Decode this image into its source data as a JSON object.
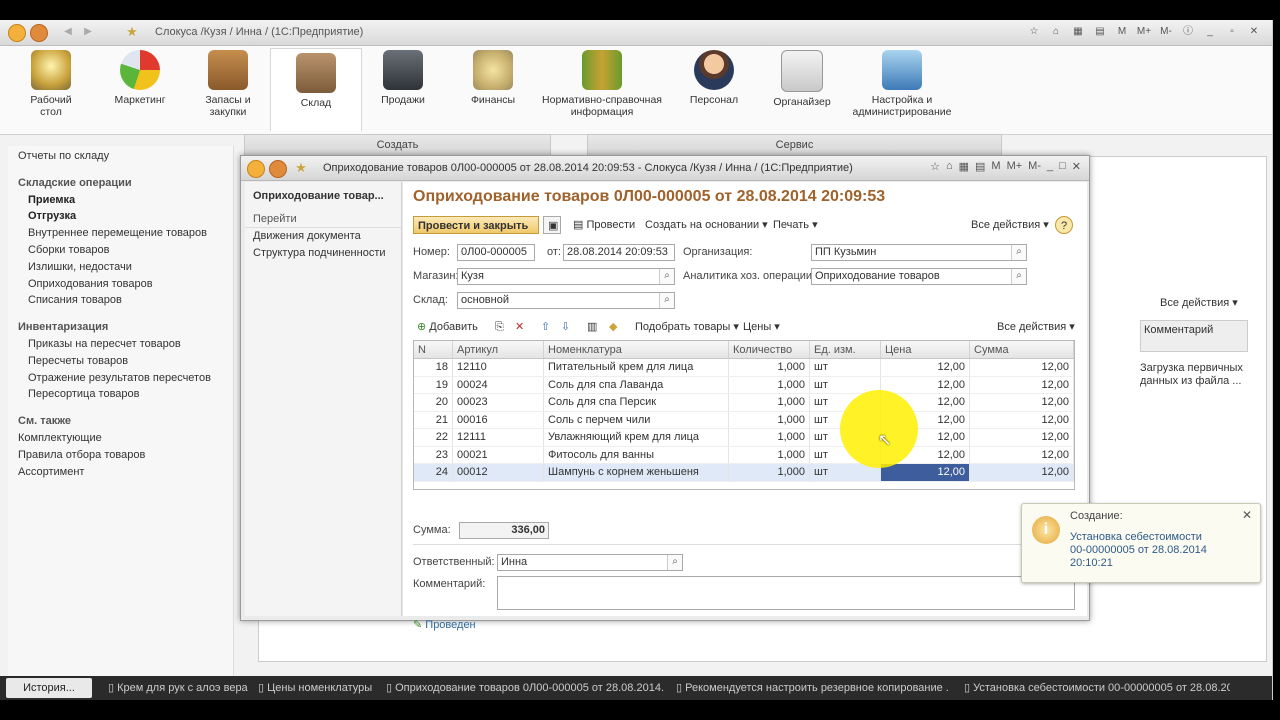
{
  "app": {
    "title": "Слокуса /Кузя / Инна /  (1С:Предприятие)"
  },
  "sections": [
    {
      "label": "Рабочий стол",
      "icon": "desktop-icon"
    },
    {
      "label": "Маркетинг",
      "icon": "pie-chart-icon"
    },
    {
      "label": "Запасы и закупки",
      "icon": "boxes-icon"
    },
    {
      "label": "Склад",
      "icon": "warehouse-icon"
    },
    {
      "label": "Продажи",
      "icon": "cash-register-icon"
    },
    {
      "label": "Финансы",
      "icon": "coins-icon"
    },
    {
      "label": "Нормативно-справочная информация",
      "icon": "binders-icon"
    },
    {
      "label": "Персонал",
      "icon": "person-icon"
    },
    {
      "label": "Органайзер",
      "icon": "checklist-icon"
    },
    {
      "label": "Настройка и администрирование",
      "icon": "computer-icon"
    }
  ],
  "subbar": {
    "create": "Создать",
    "service": "Сервис"
  },
  "leftnav": {
    "reports": "Отчеты по складу",
    "ops_header": "Складские операции",
    "ops": [
      "Приемка",
      "Отгрузка",
      "Внутреннее перемещение товаров",
      "Сборки товаров",
      "Излишки, недостачи",
      "Оприходования товаров",
      "Списания товаров"
    ],
    "inv_header": "Инвентаризация",
    "inv": [
      "Приказы на пересчет товаров",
      "Пересчеты товаров",
      "Отражение результатов пересчетов",
      "Пересортица товаров"
    ],
    "see_header": "См. также",
    "see": [
      "Комплектующие",
      "Правила отбора товаров",
      "Ассортимент"
    ]
  },
  "background": {
    "all_actions": "Все действия",
    "comment_col": "Комментарий",
    "comment_cell": "Загрузка первичных данных из файла ..."
  },
  "dialog": {
    "window_title": "Оприходование товаров 0Л00-000005 от 28.08.2014 20:09:53 - Слокуса /Кузя / Инна /  (1С:Предприятие)",
    "left_title": "Оприходование товар...",
    "goto": "Перейти",
    "links": [
      "Движения документа",
      "Структура подчиненности"
    ],
    "doc_title": "Оприходование товаров 0Л00-000005 от 28.08.2014 20:09:53",
    "toolbar": {
      "post_close": "Провести и закрыть",
      "post": "Провести",
      "create_based": "Создать на основании",
      "print": "Печать",
      "all_actions": "Все действия",
      "help": "?"
    },
    "fields": {
      "number_label": "Номер:",
      "number": "0Л00-000005",
      "date_label": "от:",
      "date": "28.08.2014 20:09:53",
      "org_label": "Организация:",
      "org": "ПП Кузьмин",
      "store_label": "Магазин:",
      "store": "Кузя",
      "analytics_label": "Аналитика хоз. операции:",
      "analytics": "Оприходование товаров",
      "warehouse_label": "Склад:",
      "warehouse": "основной"
    },
    "table_toolbar": {
      "add": "Добавить",
      "pick": "Подобрать товары",
      "prices": "Цены",
      "all_actions": "Все действия"
    },
    "columns": [
      "N",
      "Артикул",
      "Номенклатура",
      "Количество",
      "Ед. изм.",
      "Цена",
      "Сумма"
    ],
    "rows": [
      {
        "n": "18",
        "sku": "12110",
        "name": "Питательный крем для лица",
        "qty": "1,000",
        "unit": "шт",
        "price": "12,00",
        "sum": "12,00"
      },
      {
        "n": "19",
        "sku": "00024",
        "name": "Соль для спа Лаванда",
        "qty": "1,000",
        "unit": "шт",
        "price": "12,00",
        "sum": "12,00"
      },
      {
        "n": "20",
        "sku": "00023",
        "name": "Соль для спа Персик",
        "qty": "1,000",
        "unit": "шт",
        "price": "12,00",
        "sum": "12,00"
      },
      {
        "n": "21",
        "sku": "00016",
        "name": "Соль с перчем чили",
        "qty": "1,000",
        "unit": "шт",
        "price": "12,00",
        "sum": "12,00"
      },
      {
        "n": "22",
        "sku": "12111",
        "name": "Увлажняющий крем для лица",
        "qty": "1,000",
        "unit": "шт",
        "price": "12,00",
        "sum": "12,00"
      },
      {
        "n": "23",
        "sku": "00021",
        "name": "Фитосоль для ванны",
        "qty": "1,000",
        "unit": "шт",
        "price": "12,00",
        "sum": "12,00"
      },
      {
        "n": "24",
        "sku": "00012",
        "name": "Шампунь с корнем женьшеня",
        "qty": "1,000",
        "unit": "шт",
        "price": "12,00",
        "sum": "12,00"
      }
    ],
    "sum_label": "Сумма:",
    "sum": "336,00",
    "responsible_label": "Ответственный:",
    "responsible": "Инна",
    "comment_label": "Комментарий:",
    "status": "Проведен"
  },
  "notification": {
    "title": "Создание:",
    "text": "Установка себестоимости 00-00000005 от 28.08.2014 20:10:21"
  },
  "taskbar": {
    "history": "История...",
    "items": [
      "Крем для рук с алоэ вера",
      "Цены номенклатуры",
      "Оприходование товаров 0Л00-000005 от 28.08.2014...",
      "Рекомендуется настроить резервное копирование ...",
      "Установка себестоимости 00-00000005 от 28.08.20..."
    ]
  }
}
